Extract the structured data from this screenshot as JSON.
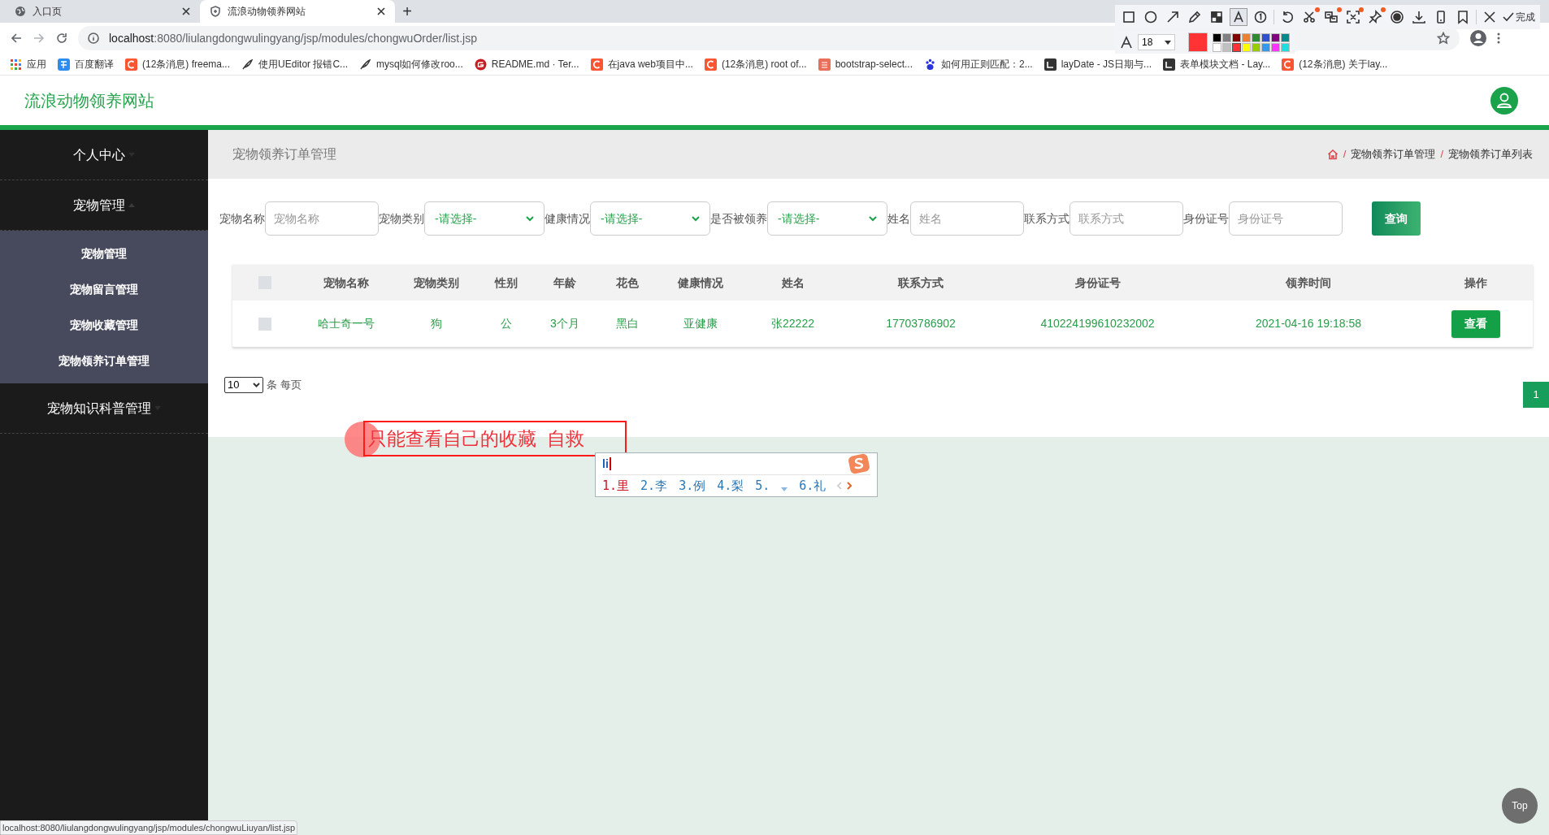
{
  "browser": {
    "tabs": [
      {
        "title": "入口页",
        "kind": "globe",
        "selected": false
      },
      {
        "title": "流浪动物领养网站",
        "kind": "shield",
        "selected": true
      }
    ],
    "new_tab": "+",
    "url": {
      "host": "localhost",
      "rest": ":8080/liulangdongwulingyang/jsp/modules/chongwuOrder/list.jsp"
    },
    "bookmarks": [
      {
        "label": "应用",
        "kind": "apps"
      },
      {
        "label": "百度翻译",
        "kind": "translate"
      },
      {
        "label": "(12条消息) freema...",
        "kind": "csdn"
      },
      {
        "label": "使用UEditor 报错C...",
        "kind": "feather"
      },
      {
        "label": "mysql如何修改roo...",
        "kind": "feather"
      },
      {
        "label": "README.md · Ter...",
        "kind": "gitee"
      },
      {
        "label": "在java web项目中...",
        "kind": "csdn"
      },
      {
        "label": "(12条消息) root of...",
        "kind": "csdn"
      },
      {
        "label": "bootstrap-select...",
        "kind": "jianshu"
      },
      {
        "label": "如何用正则匹配：2...",
        "kind": "baidu"
      },
      {
        "label": "layDate - JS日期与...",
        "kind": "layui"
      },
      {
        "label": "表单模块文档 - Lay...",
        "kind": "layui"
      },
      {
        "label": "(12条消息) 关于lay...",
        "kind": "csdn"
      }
    ]
  },
  "site": {
    "title": "流浪动物领养网站"
  },
  "sidebar": [
    {
      "label": "个人中心",
      "expanded": false
    },
    {
      "label": "宠物管理",
      "expanded": true,
      "children": [
        {
          "label": "宠物管理"
        },
        {
          "label": "宠物留言管理"
        },
        {
          "label": "宠物收藏管理"
        },
        {
          "label": "宠物领养订单管理"
        }
      ]
    },
    {
      "label": "宠物知识科普管理",
      "expanded": false
    }
  ],
  "page_title": "宠物领养订单管理",
  "breadcrumb": [
    {
      "separator": "/",
      "label": "宠物领养订单管理"
    },
    {
      "separator": "/",
      "label": "宠物领养订单列表"
    }
  ],
  "search": {
    "fields": [
      {
        "label": "宠物名称",
        "kind": "text",
        "placeholder": "宠物名称"
      },
      {
        "label": "宠物类别",
        "kind": "select",
        "value": "-请选择-"
      },
      {
        "label": "健康情况",
        "kind": "select",
        "value": "-请选择-"
      },
      {
        "label": "是否被领养",
        "kind": "select",
        "value": "-请选择-"
      },
      {
        "label": "姓名",
        "kind": "text",
        "placeholder": "姓名"
      },
      {
        "label": "联系方式",
        "kind": "text",
        "placeholder": "联系方式"
      },
      {
        "label": "身份证号",
        "kind": "text",
        "placeholder": "身份证号"
      }
    ],
    "button": "查询"
  },
  "table": {
    "select_all": {
      "checked": false
    },
    "columns": [
      "宠物名称",
      "宠物类别",
      "性别",
      "年龄",
      "花色",
      "健康情况",
      "姓名",
      "联系方式",
      "身份证号",
      "领养时间",
      "操作"
    ],
    "rows": [
      {
        "checked": false,
        "cells": [
          "哈士奇一号",
          "狗",
          "公",
          "3个月",
          "黑白",
          "亚健康",
          "张22222",
          "17703786902",
          "410224199610232002",
          "2021-04-16 19:18:58"
        ],
        "action": "查看"
      }
    ]
  },
  "page_size": {
    "value": "10",
    "suffix": "条 每页"
  },
  "pages": [
    {
      "label": "1",
      "selected": true
    }
  ],
  "annotation_tool": {
    "tools": [
      {
        "kind": "rect",
        "selected": false,
        "badge": false
      },
      {
        "kind": "ellipse",
        "selected": false,
        "badge": false
      },
      {
        "kind": "arrow",
        "selected": false,
        "badge": false
      },
      {
        "kind": "pencil",
        "selected": false,
        "badge": false
      },
      {
        "kind": "mosaic",
        "selected": false,
        "badge": false
      },
      {
        "kind": "text",
        "selected": true,
        "badge": false
      },
      {
        "kind": "number",
        "selected": false,
        "badge": false
      },
      {
        "kind": "undo",
        "selected": false,
        "badge": false
      },
      {
        "kind": "scissors",
        "selected": false,
        "badge": true
      },
      {
        "kind": "translate",
        "selected": false,
        "badge": true
      },
      {
        "kind": "scan",
        "selected": false,
        "badge": true
      },
      {
        "kind": "pin",
        "selected": false,
        "badge": true
      },
      {
        "kind": "record",
        "selected": false,
        "badge": false
      },
      {
        "kind": "download",
        "selected": false,
        "badge": false
      },
      {
        "kind": "phone",
        "selected": false,
        "badge": false
      },
      {
        "kind": "bookmark",
        "selected": false,
        "badge": false
      },
      {
        "kind": "close",
        "selected": false,
        "badge": false
      }
    ],
    "done": "完成",
    "font_size": "18",
    "palette": [
      {
        "color": "#000000",
        "selected": false
      },
      {
        "color": "#808080",
        "selected": false
      },
      {
        "color": "#800000",
        "selected": false
      },
      {
        "color": "#f08030",
        "selected": false
      },
      {
        "color": "#2e8b2e",
        "selected": false
      },
      {
        "color": "#3050d0",
        "selected": false
      },
      {
        "color": "#800080",
        "selected": false
      },
      {
        "color": "#008b8b",
        "selected": false
      },
      {
        "color": "#ffffff",
        "selected": false
      },
      {
        "color": "#c0c0c0",
        "selected": false
      },
      {
        "color": "#ff3333",
        "selected": true
      },
      {
        "color": "#ffff00",
        "selected": false
      },
      {
        "color": "#99cc00",
        "selected": false
      },
      {
        "color": "#3399ee",
        "selected": false
      },
      {
        "color": "#ff33ff",
        "selected": false
      },
      {
        "color": "#22dddd",
        "selected": false
      }
    ]
  },
  "annotation_text": "只能查看自己的收藏  自救",
  "ime": {
    "input": "li",
    "candidates": [
      {
        "label": "1.里",
        "selected": true
      },
      {
        "label": "2.李",
        "selected": false
      },
      {
        "label": "3.例",
        "selected": false
      },
      {
        "label": "4.梨",
        "selected": false
      },
      {
        "label": "5.",
        "selected": false
      },
      {
        "label": "6.礼",
        "selected": false
      }
    ]
  },
  "status_url": "localhost:8080/liulangdongwulingyang/jsp/modules/chongwuLiuyan/list.jsp",
  "top_button": "Top"
}
